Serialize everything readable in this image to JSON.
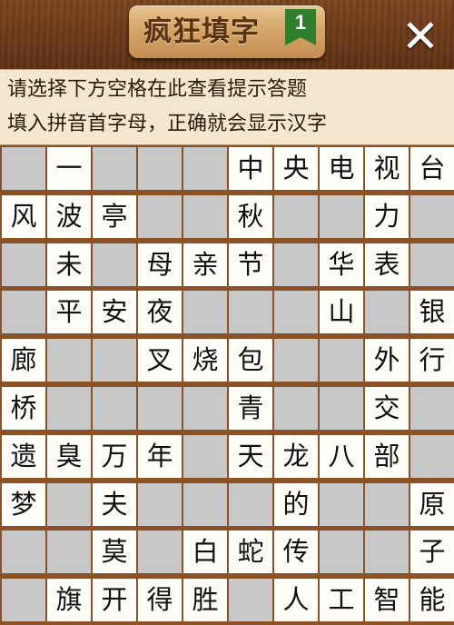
{
  "header": {
    "title": "疯狂填字",
    "level": "1",
    "close_label": "✕"
  },
  "hint": {
    "line1": "请选择下方空格在此查看提示答题",
    "line2": "填入拼音首字母，正确就会显示汉字"
  },
  "board": {
    "rows": [
      [
        "#",
        "一",
        "#",
        "#",
        "#",
        "中",
        "央",
        "电",
        "视",
        "台"
      ],
      [
        "风",
        "波",
        "亭",
        "#",
        "#",
        "秋",
        "#",
        "#",
        "力",
        "#"
      ],
      [
        "#",
        "未",
        "#",
        "母",
        "亲",
        "节",
        "#",
        "华",
        "表",
        "#"
      ],
      [
        "#",
        "平",
        "安",
        "夜",
        "#",
        "#",
        "#",
        "山",
        "#",
        "银"
      ],
      [
        "廊",
        "#",
        "#",
        "叉",
        "烧",
        "包",
        "#",
        "#",
        "外",
        "行"
      ],
      [
        "桥",
        "#",
        "#",
        "#",
        "#",
        "青",
        "#",
        "#",
        "交",
        "#"
      ],
      [
        "遗",
        "臭",
        "万",
        "年",
        "#",
        "天",
        "龙",
        "八",
        "部",
        "#"
      ],
      [
        "梦",
        "#",
        "夫",
        "#",
        "#",
        "#",
        "的",
        "#",
        "#",
        "原"
      ],
      [
        "#",
        "#",
        "莫",
        "#",
        "白",
        "蛇",
        "传",
        "#",
        "#",
        "子"
      ],
      [
        "#",
        "旗",
        "开",
        "得",
        "胜",
        "#",
        "人",
        "工",
        "智",
        "能"
      ]
    ]
  },
  "colors": {
    "board_frame": "#8a5226",
    "cell_white": "#fffdf8",
    "cell_gray": "#c8c8c8",
    "hint_bg": "#f5e6cf",
    "badge_green": "#2f7f2c"
  }
}
